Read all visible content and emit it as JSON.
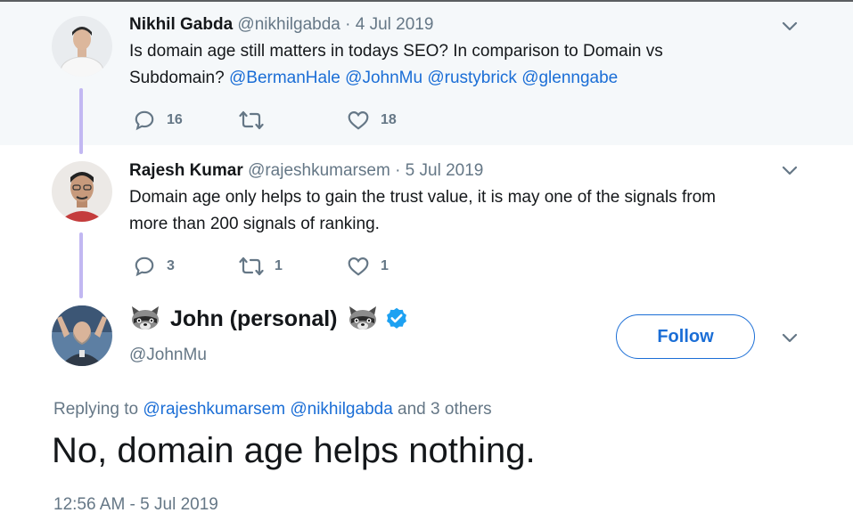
{
  "tweets": [
    {
      "name": "Nikhil Gabda",
      "handle": "@nikhilgabda",
      "separator": "·",
      "date": "4 Jul 2019",
      "text_line1": "Is domain age still matters in todays SEO? In comparison to Domain vs",
      "text_line2_prefix": "Subdomain?",
      "mentions": [
        "@BermanHale",
        "@JohnMu",
        "@rustybrick",
        "@glenngabe"
      ],
      "replies": "16",
      "retweets": "",
      "likes": "18"
    },
    {
      "name": "Rajesh Kumar",
      "handle": "@rajeshkumarsem",
      "separator": "·",
      "date": "5 Jul 2019",
      "text_line1": "Domain age only helps to gain the trust value, it is may one of the signals from",
      "text_line2": "more than 200 signals of ranking.",
      "replies": "3",
      "retweets": "1",
      "likes": "1"
    }
  ],
  "main_tweet": {
    "name": "John (personal)",
    "handle": "@JohnMu",
    "follow_label": "Follow",
    "replying_prefix": "Replying to",
    "replying_to": [
      "@rajeshkumarsem",
      "@nikhilgabda"
    ],
    "replying_suffix": "and 3 others",
    "text": "No, domain age helps nothing.",
    "timestamp": "12:56 AM - 5 Jul 2019",
    "emoji_left": "raccoon-icon",
    "emoji_right": "raccoon-icon",
    "verified": "verified-badge-icon"
  },
  "colors": {
    "link": "#1b6ed6",
    "muted": "#657786",
    "thread_line": "#c2b8f2",
    "highlight_bg": "#f5f8fa"
  }
}
